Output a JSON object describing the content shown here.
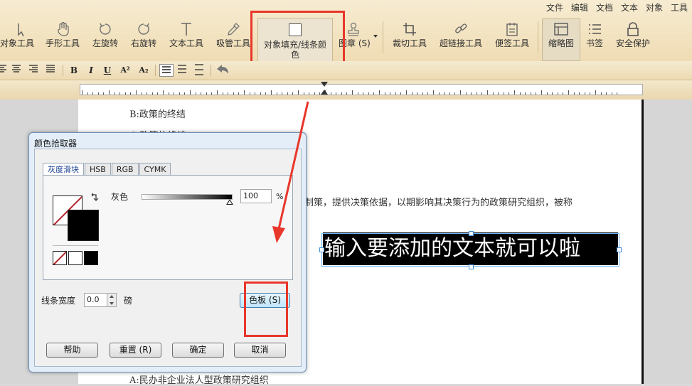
{
  "menubar": [
    "文件",
    "编辑",
    "文档",
    "文本",
    "对象",
    "工具"
  ],
  "toolbar": {
    "object_tool": "对象工具",
    "hand_tool": "手形工具",
    "rotate_left": "左旋转",
    "rotate_right": "右旋转",
    "text_tool": "文本工具",
    "eyedropper_tool": "吸管工具",
    "fill_line_color_line1": "对象填充/线条颜",
    "fill_line_color_line2": "色",
    "image_tool": "图章 (S)",
    "crop_tool": "裁切工具",
    "hyperlink_tool": "超链接工具",
    "note_tool": "便签工具",
    "thumbnail": "缩略图",
    "bookmark": "书签",
    "security": "安全保护"
  },
  "format_bar": {
    "bold": "B",
    "italic": "I",
    "underline": "U",
    "superscript": "A²",
    "subscript": "A₂"
  },
  "document": {
    "line_b": "B:政策的终结",
    "line_c": "C:政策的终结",
    "body_fragment": "制策，提供决策依据，以期影响其决策行为的政策研究组织，被称",
    "textbox_text": "输入要添加的文本就可以啦",
    "line_a": "A:民办非企业法人型政策研究组织"
  },
  "dialog": {
    "title": "颜色拾取器",
    "tabs": [
      "灰度滑块",
      "HSB",
      "RGB",
      "CYMK"
    ],
    "gray_label": "灰色",
    "gray_value": "100",
    "percent": "%",
    "line_width_label": "线条宽度",
    "line_width_value": "0.0",
    "unit": "磅",
    "palette_button": "色板 (S)",
    "help_button": "帮助",
    "reset_button": "重置 (R)",
    "ok_button": "确定",
    "cancel_button": "取消"
  },
  "colors": {
    "highlight_red": "#e8372b",
    "ribbon_top": "#f7ecd2",
    "dialog_bg": "#e3eef9",
    "text_fill": "#000000"
  }
}
